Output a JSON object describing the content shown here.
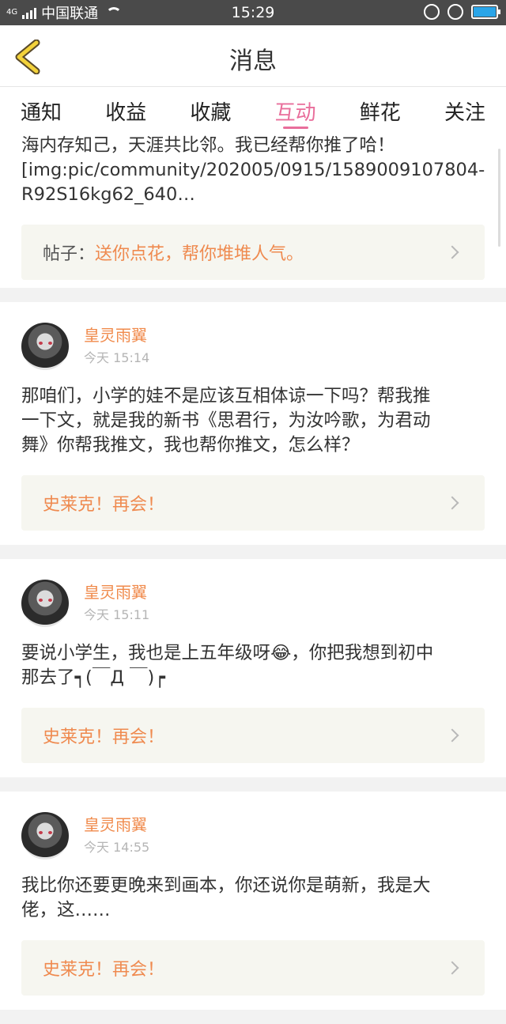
{
  "status_bar": {
    "network_type": "4G",
    "carrier": "中国联通",
    "time": "15:29"
  },
  "header": {
    "back_icon": "chevron-left-icon",
    "title": "消息"
  },
  "tabs": [
    {
      "label": "通知",
      "active": false
    },
    {
      "label": "收益",
      "active": false
    },
    {
      "label": "收藏",
      "active": false
    },
    {
      "label": "互动",
      "active": true
    },
    {
      "label": "鲜花",
      "active": false
    },
    {
      "label": "关注",
      "active": false
    }
  ],
  "colors": {
    "accent_pink": "#e96e9b",
    "accent_orange": "#f08a4b"
  },
  "messages": [
    {
      "text_line1": "海内存知己，天涯共比邻。我已经帮你推了哈！",
      "text_line2": "[img:pic/community/202005/0915/1589009107804-",
      "text_line3": "R92S16kg62_640…",
      "reply_prefix": "帖子：",
      "reply_text": "送你点花，帮你堆堆人气。"
    },
    {
      "user": "皇灵雨翼",
      "time": "今天 15:14",
      "text_line1": "那咱们，小学的娃不是应该互相体谅一下吗？帮我推",
      "text_line2": "一下文，就是我的新书《思君行，为汝吟歌，为君动",
      "text_line3": "舞》你帮我推文，我也帮你推文，怎么样？",
      "reply_text": "史莱克！再会！"
    },
    {
      "user": "皇灵雨翼",
      "time": "今天 15:11",
      "text_line1": "要说小学生，我也是上五年级呀😂，你把我想到初中",
      "text_line2": "那去了┑(￣Д ￣)┍",
      "reply_text": "史莱克！再会！"
    },
    {
      "user": "皇灵雨翼",
      "time": "今天 14:55",
      "text_line1": "我比你还要更晚来到画本，你还说你是萌新，我是大",
      "text_line2": "佬，这……",
      "reply_text": "史莱克！再会！"
    }
  ]
}
